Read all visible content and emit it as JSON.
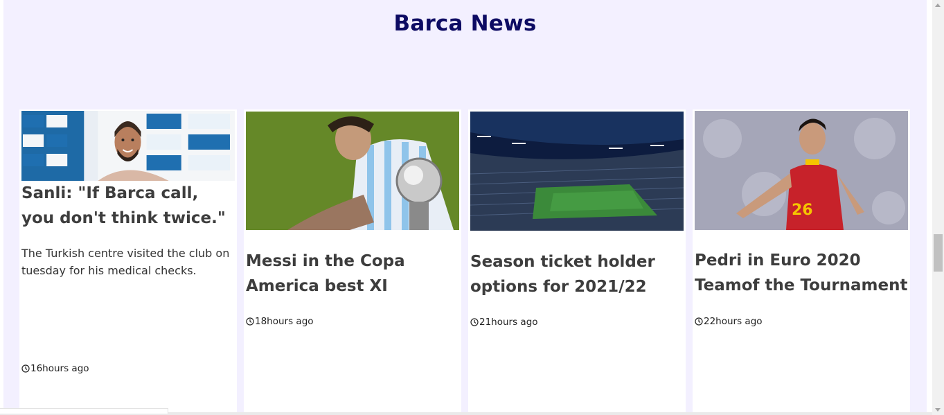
{
  "section": {
    "title": "Barca News"
  },
  "articles": [
    {
      "headline": "Sanli: \"If Barca call, you don't think twice.\"",
      "summary": "The Turkish centre visited the club on tuesday for his medical checks.",
      "time": "16hours ago",
      "image": "player-press-photo"
    },
    {
      "headline": "Messi in the Copa America best XI",
      "summary": "",
      "time": "18hours ago",
      "image": "messi-with-trophy"
    },
    {
      "headline": "Season ticket holder options for 2021/22",
      "summary": "",
      "time": "21hours ago",
      "image": "stadium-night"
    },
    {
      "headline": "Pedri in Euro 2020 Teamof the Tournament",
      "summary": "",
      "time": "22hours ago",
      "image": "pedri-spain-kit"
    }
  ],
  "colors": {
    "page_background": "#f3f0ff",
    "title": "#0d0b63",
    "headline": "#3d3d3d"
  },
  "icons": {
    "time": "clock-icon"
  }
}
